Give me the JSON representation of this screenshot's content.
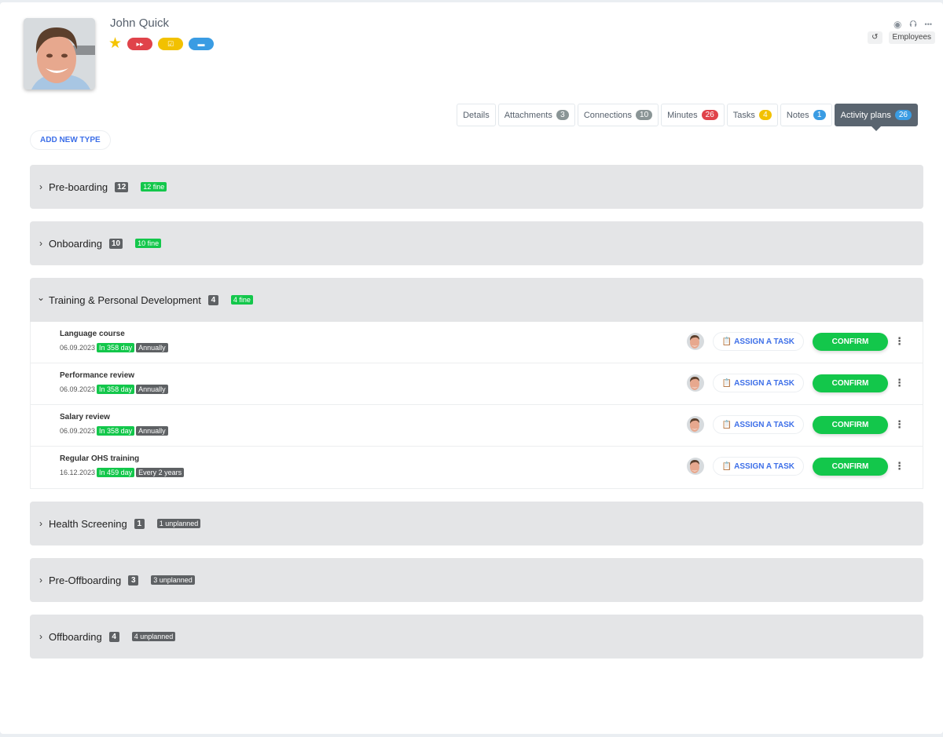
{
  "profile": {
    "name": "John Quick",
    "badges": [
      {
        "icon": "fast-forward-icon",
        "glyph": "⏩",
        "color": "#e0434a"
      },
      {
        "icon": "checklist-icon",
        "glyph": "☑",
        "color": "#f2c100"
      },
      {
        "icon": "chat-icon",
        "glyph": "▬",
        "color": "#3a9ce3"
      }
    ],
    "star_color": "#f5c400"
  },
  "top_actions": {
    "view_icon": "◉",
    "share_icon": "⮉",
    "more_icon": "•••",
    "history_icon": "↺",
    "category_tag": "Employees"
  },
  "tabs": [
    {
      "label": "Details",
      "count": null,
      "color": null
    },
    {
      "label": "Attachments",
      "count": "3",
      "color": "#8a9596"
    },
    {
      "label": "Connections",
      "count": "10",
      "color": "#8a9596"
    },
    {
      "label": "Minutes",
      "count": "26",
      "color": "#e0434a"
    },
    {
      "label": "Tasks",
      "count": "4",
      "color": "#f2c100"
    },
    {
      "label": "Notes",
      "count": "1",
      "color": "#3a9ce3"
    },
    {
      "label": "Activity plans",
      "count": "26",
      "color": "#3a9ce3",
      "active": true
    }
  ],
  "add_new_type_label": "ADD NEW TYPE",
  "sections": [
    {
      "title": "Pre-boarding",
      "count": "12",
      "status": "12 fine",
      "status_type": "fine",
      "expanded": false
    },
    {
      "title": "Onboarding",
      "count": "10",
      "status": "10 fine",
      "status_type": "fine",
      "expanded": false
    },
    {
      "title": "Training & Personal Development",
      "count": "4",
      "status": "4 fine",
      "status_type": "fine",
      "expanded": true,
      "items": [
        {
          "title": "Language course",
          "date": "06.09.2023",
          "due": "In 358 day",
          "recurrence": "Annually"
        },
        {
          "title": "Performance review",
          "date": "06.09.2023",
          "due": "In 358 day",
          "recurrence": "Annually"
        },
        {
          "title": "Salary review",
          "date": "06.09.2023",
          "due": "In 358 day",
          "recurrence": "Annually"
        },
        {
          "title": "Regular OHS training",
          "date": "16.12.2023",
          "due": "In 459 day",
          "recurrence": "Every 2 years"
        }
      ]
    },
    {
      "title": "Health Screening",
      "count": "1",
      "status": "1 unplanned",
      "status_type": "unplanned",
      "expanded": false
    },
    {
      "title": "Pre-Offboarding",
      "count": "3",
      "status": "3 unplanned",
      "status_type": "unplanned",
      "expanded": false
    },
    {
      "title": "Offboarding",
      "count": "4",
      "status": "4 unplanned",
      "status_type": "unplanned",
      "expanded": false
    }
  ],
  "row_actions": {
    "assign_label": "ASSIGN A TASK",
    "confirm_label": "CONFIRM",
    "kebab": "⋮"
  },
  "chevrons": {
    "collapsed": "›",
    "expanded": "⌄"
  }
}
